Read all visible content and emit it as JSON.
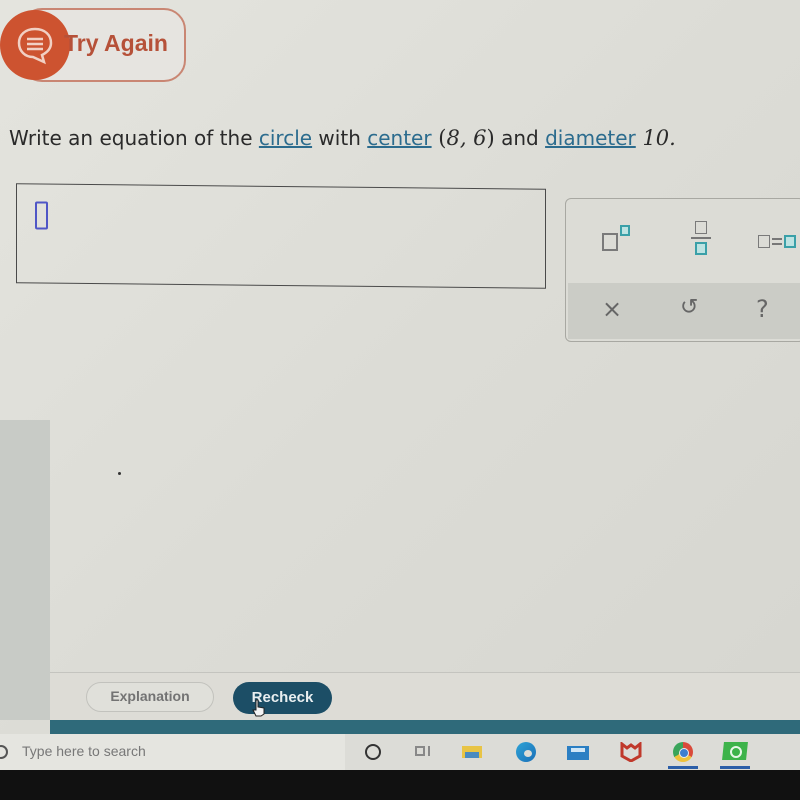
{
  "feedback": {
    "try_again_label": "Try Again",
    "icon": "chat-bubble-icon",
    "accent": "#cd5330"
  },
  "question": {
    "prefix": "Write an equation of the ",
    "link1": "circle",
    "mid1": " with ",
    "link2": "center",
    "point_open": " (",
    "point_values": "8, 6",
    "point_close": ")",
    "mid2": " and ",
    "link3": "diameter",
    "value": " 10.",
    "link_color": "#2c6c8e"
  },
  "answer": {
    "value": "",
    "cursor_icon": "empty-placeholder-box"
  },
  "keypad": {
    "buttons": [
      {
        "name": "superscript",
        "icon": "superscript-icon"
      },
      {
        "name": "fraction",
        "icon": "fraction-icon"
      },
      {
        "name": "equals",
        "icon": "equation-icon"
      },
      {
        "name": "clear",
        "label": "×",
        "icon": "clear-icon"
      },
      {
        "name": "undo",
        "label": "↺",
        "icon": "undo-icon"
      },
      {
        "name": "help",
        "label": "?",
        "icon": "help-icon"
      }
    ]
  },
  "footer": {
    "explanation_label": "Explanation",
    "recheck_label": "Recheck",
    "recheck_color": "#1c4e66"
  },
  "taskbar": {
    "search_placeholder": "Type here to search",
    "icons": [
      "cortana-icon",
      "task-view-icon",
      "file-explorer-icon",
      "edge-icon",
      "mail-icon",
      "mcafee-icon",
      "chrome-icon",
      "green-app-icon"
    ]
  }
}
